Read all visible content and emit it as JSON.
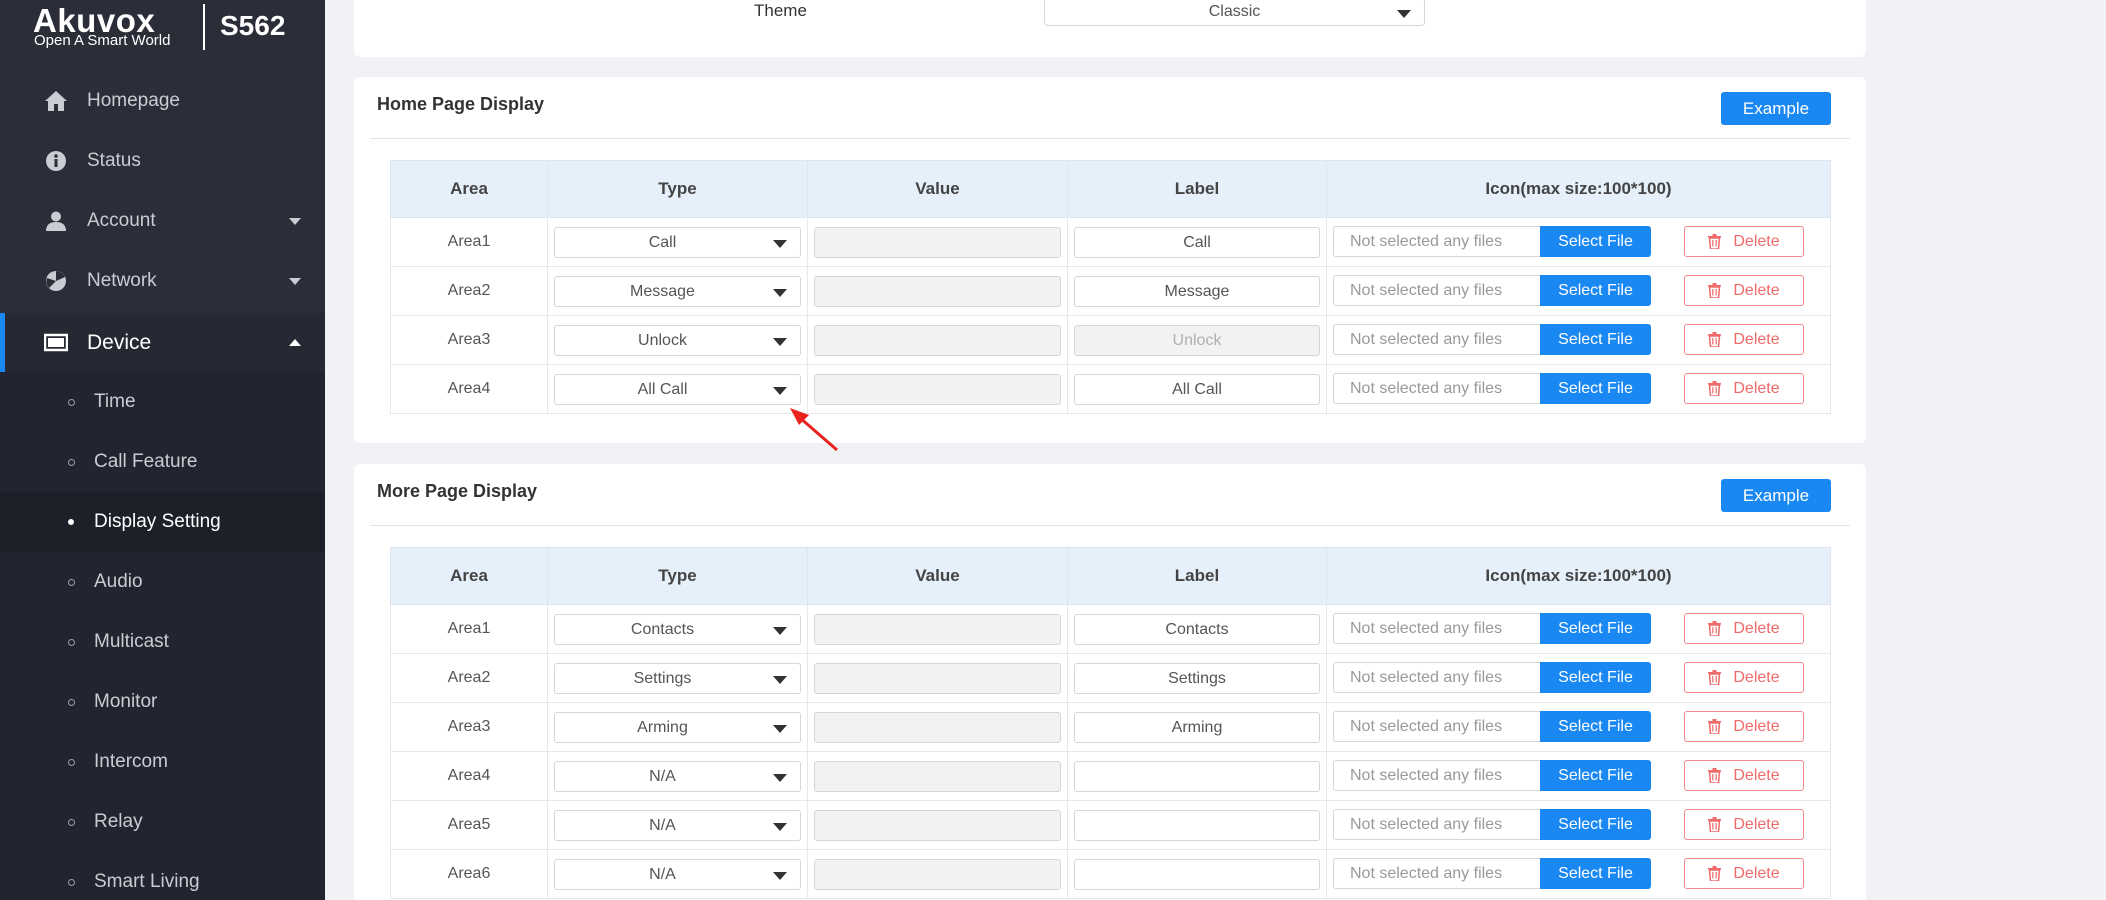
{
  "sidebar": {
    "brand": "Akuvox",
    "slogan": "Open A Smart World",
    "model": "S562",
    "items": [
      {
        "label": "Homepage",
        "icon": "home-icon"
      },
      {
        "label": "Status",
        "icon": "info-icon"
      },
      {
        "label": "Account",
        "icon": "user-icon",
        "expandable": true
      },
      {
        "label": "Network",
        "icon": "network-icon",
        "expandable": true
      },
      {
        "label": "Device",
        "icon": "monitor-icon",
        "expandable": true,
        "expanded": true,
        "active": true
      }
    ],
    "submenu": [
      {
        "label": "Time"
      },
      {
        "label": "Call Feature"
      },
      {
        "label": "Display Setting",
        "active": true
      },
      {
        "label": "Audio"
      },
      {
        "label": "Multicast"
      },
      {
        "label": "Monitor"
      },
      {
        "label": "Intercom"
      },
      {
        "label": "Relay"
      },
      {
        "label": "Smart Living"
      }
    ]
  },
  "theme": {
    "label": "Theme",
    "value": "Classic"
  },
  "headers": [
    "Area",
    "Type",
    "Value",
    "Label",
    "Icon(max size:100*100)"
  ],
  "file_placeholder": "Not selected any files",
  "select_file_label": "Select File",
  "delete_label": "Delete",
  "example_label": "Example",
  "home_page": {
    "title": "Home Page Display",
    "rows": [
      {
        "area": "Area1",
        "type": "Call",
        "value": "",
        "label": "Call",
        "label_disabled": false
      },
      {
        "area": "Area2",
        "type": "Message",
        "value": "",
        "label": "Message",
        "label_disabled": false
      },
      {
        "area": "Area3",
        "type": "Unlock",
        "value": "",
        "label": "Unlock",
        "label_disabled": true
      },
      {
        "area": "Area4",
        "type": "All Call",
        "value": "",
        "label": "All Call",
        "label_disabled": false
      }
    ]
  },
  "more_page": {
    "title": "More Page Display",
    "rows": [
      {
        "area": "Area1",
        "type": "Contacts",
        "value": "",
        "label": "Contacts",
        "label_disabled": false
      },
      {
        "area": "Area2",
        "type": "Settings",
        "value": "",
        "label": "Settings",
        "label_disabled": false
      },
      {
        "area": "Area3",
        "type": "Arming",
        "value": "",
        "label": "Arming",
        "label_disabled": false
      },
      {
        "area": "Area4",
        "type": "N/A",
        "value": "",
        "label": "",
        "label_disabled": false
      },
      {
        "area": "Area5",
        "type": "N/A",
        "value": "",
        "label": "",
        "label_disabled": false
      },
      {
        "area": "Area6",
        "type": "N/A",
        "value": "",
        "label": "",
        "label_disabled": false
      }
    ]
  },
  "colors": {
    "accent": "#1a88f2",
    "sidebar": "#2b2e39",
    "delete": "#f06a6a",
    "annotation": "#e8231f"
  }
}
